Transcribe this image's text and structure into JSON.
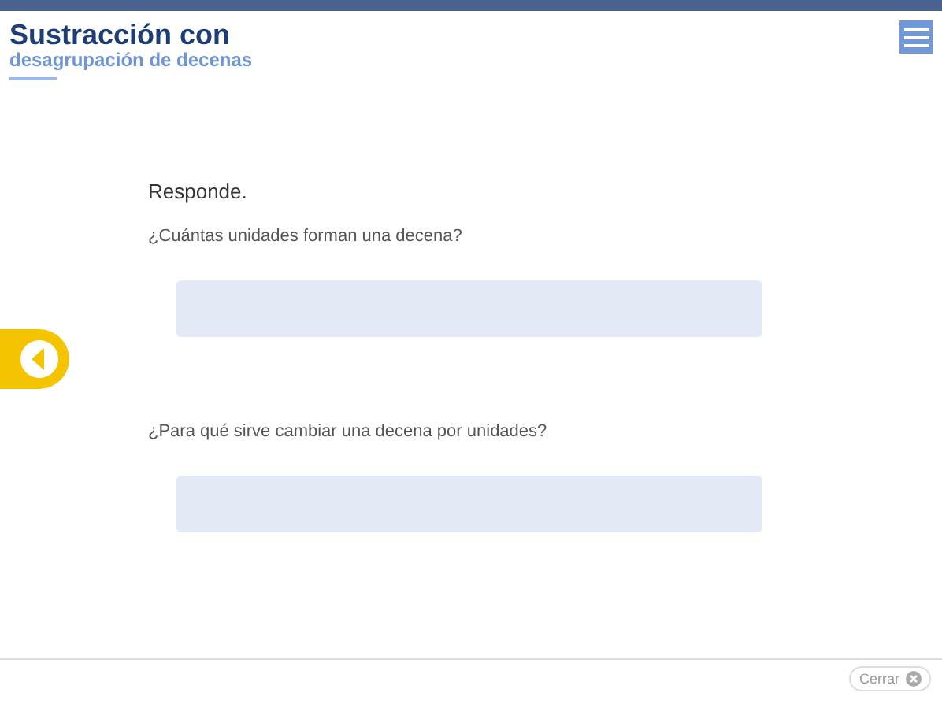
{
  "header": {
    "title": "Sustracción con",
    "subtitle": "desagrupación de decenas"
  },
  "instruction": "Responde.",
  "questions": [
    {
      "prompt": "¿Cuántas unidades forman una decena?"
    },
    {
      "prompt": "¿Para qué sirve cambiar una decena por unidades?"
    }
  ],
  "close_button": {
    "label": "Cerrar"
  }
}
